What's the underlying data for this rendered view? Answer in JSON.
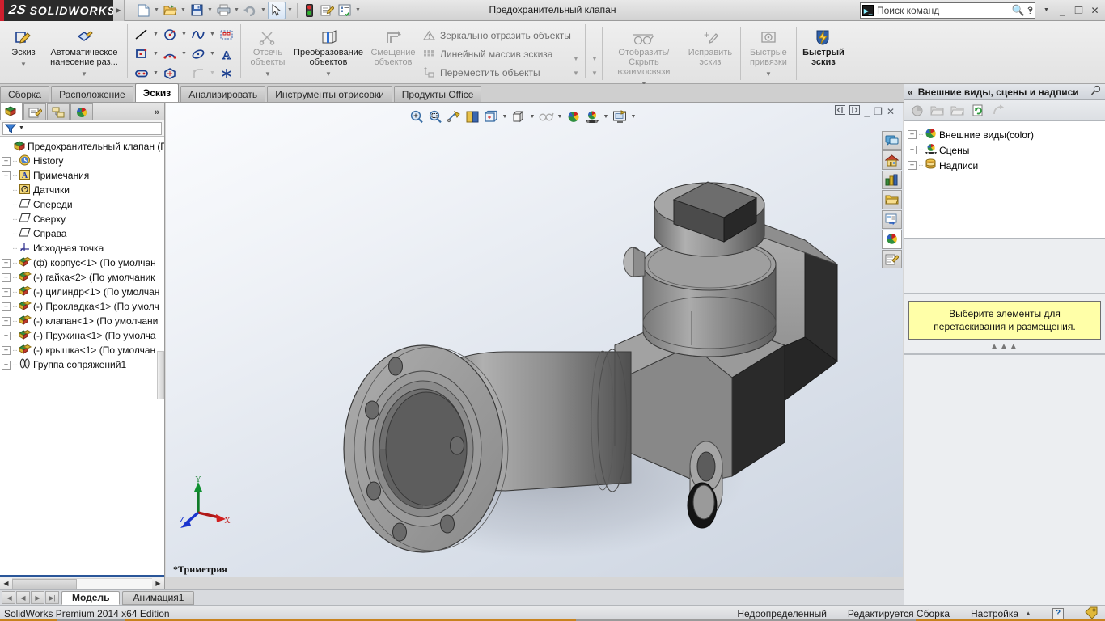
{
  "app": {
    "brand": "SOLIDWORKS",
    "brand_mark": "2S",
    "document_title": "Предохранительный клапан",
    "edition": "SolidWorks Premium 2014 x64 Edition"
  },
  "search": {
    "placeholder": "Поиск команд",
    "icon": "command-search-icon",
    "magnifier": "search-icon"
  },
  "quick_access": [
    {
      "name": "new-document",
      "icon": "📄"
    },
    {
      "name": "open-document",
      "icon": "📂"
    },
    {
      "name": "save-document",
      "icon": "💾"
    },
    {
      "name": "print-document",
      "icon": "🖨"
    },
    {
      "name": "undo",
      "icon": "↺"
    },
    {
      "name": "select",
      "icon": "➤"
    },
    {
      "name": "rebuild",
      "icon": "🚦"
    },
    {
      "name": "file-properties",
      "icon": "📝"
    },
    {
      "name": "options",
      "icon": "📋"
    }
  ],
  "window_buttons": [
    "help",
    "minimize",
    "restore",
    "close"
  ],
  "ribbon": {
    "groups": [
      {
        "name": "sketch-group",
        "buttons": [
          {
            "label": "Эскиз",
            "icon": "sketch-icon",
            "glyph": "✏",
            "disabled": false,
            "dropdown": true
          },
          {
            "label": "Автоматическое нанесение раз...",
            "icon": "smart-dimension-icon",
            "glyph": "◈",
            "disabled": false,
            "dropdown": true
          }
        ]
      },
      {
        "name": "entities-group",
        "rows": [
          [
            {
              "name": "line-tool",
              "glyph": "╲",
              "caret": true
            },
            {
              "name": "circle-tool",
              "glyph": "◯",
              "caret": true
            },
            {
              "name": "spline-tool",
              "glyph": "∿",
              "caret": true
            },
            {
              "name": "sketch-pattern-tool",
              "glyph": "▦",
              "caret": false
            }
          ],
          [
            {
              "name": "rectangle-tool",
              "glyph": "▭",
              "caret": true
            },
            {
              "name": "arc-tool",
              "glyph": "⌒",
              "caret": true
            },
            {
              "name": "ellipse-tool",
              "glyph": "⬭",
              "caret": true
            },
            {
              "name": "text-tool",
              "glyph": "A",
              "caret": false
            }
          ],
          [
            {
              "name": "slot-tool",
              "glyph": "⬬",
              "caret": true
            },
            {
              "name": "polygon-tool",
              "glyph": "⬡",
              "caret": false
            },
            {
              "name": "fillet-tool",
              "glyph": "⌐",
              "caret": true,
              "disabled": true
            },
            {
              "name": "point-tool",
              "glyph": "✳",
              "caret": false
            }
          ]
        ]
      },
      {
        "name": "modify-group",
        "buttons": [
          {
            "label": "Отсечь объекты",
            "icon": "trim-entities-icon",
            "glyph": "✂",
            "disabled": true,
            "dropdown": true
          },
          {
            "label": "Преобразование объектов",
            "icon": "convert-entities-icon",
            "glyph": "▱",
            "disabled": false,
            "dropdown": true
          },
          {
            "label": "Смещение объектов",
            "icon": "offset-entities-icon",
            "glyph": "⇗",
            "disabled": true,
            "dropdown": false
          }
        ],
        "list": [
          {
            "label": "Зеркально отразить объекты",
            "icon": "mirror-entities-icon",
            "glyph": "⚠"
          },
          {
            "label": "Линейный массив эскиза",
            "icon": "linear-pattern-icon",
            "glyph": "⣿"
          },
          {
            "label": "Переместить объекты",
            "icon": "move-entities-icon",
            "glyph": "⤵"
          }
        ]
      },
      {
        "name": "relations-group",
        "buttons": [
          {
            "label": "Отобразить/Скрыть взаимосвязи",
            "icon": "display-relations-icon",
            "glyph": "👓",
            "disabled": true,
            "dropdown": true
          },
          {
            "label": "Исправить эскиз",
            "icon": "repair-sketch-icon",
            "glyph": "✎",
            "disabled": true,
            "dropdown": false
          },
          {
            "label": "Быстрые привязки",
            "icon": "quick-snaps-icon",
            "glyph": "◎",
            "disabled": true,
            "dropdown": true
          },
          {
            "label": "Быстрый эскиз",
            "icon": "rapid-sketch-icon",
            "glyph": "⚡",
            "disabled": false,
            "dropdown": false
          }
        ]
      }
    ]
  },
  "command_tabs": [
    {
      "label": "Сборка",
      "active": false
    },
    {
      "label": "Расположение",
      "active": false
    },
    {
      "label": "Эскиз",
      "active": true
    },
    {
      "label": "Анализировать",
      "active": false
    },
    {
      "label": "Инструменты отрисовки",
      "active": false
    },
    {
      "label": "Продукты Office",
      "active": false
    }
  ],
  "tree_panel": {
    "tabs": [
      {
        "name": "feature-manager-tab",
        "glyph": "🗂",
        "active": true
      },
      {
        "name": "property-manager-tab",
        "glyph": "📝",
        "active": false
      },
      {
        "name": "configuration-manager-tab",
        "glyph": "🔖",
        "active": false
      },
      {
        "name": "display-manager-tab",
        "glyph": "🎨",
        "active": false
      }
    ],
    "expand_chevron": "»",
    "filter_icon": "filter-icon",
    "root": "Предохранительный клапан  (П",
    "items": [
      {
        "label": "History",
        "icon": "history-icon",
        "glyph": "🕐",
        "expandable": true
      },
      {
        "label": "Примечания",
        "icon": "annotations-icon",
        "glyph": "A",
        "expandable": true
      },
      {
        "label": "Датчики",
        "icon": "sensors-icon",
        "glyph": "◎",
        "expandable": false
      },
      {
        "label": "Спереди",
        "icon": "plane-icon",
        "glyph": "◇",
        "expandable": false
      },
      {
        "label": "Сверху",
        "icon": "plane-icon",
        "glyph": "◇",
        "expandable": false
      },
      {
        "label": "Справа",
        "icon": "plane-icon",
        "glyph": "◇",
        "expandable": false
      },
      {
        "label": "Исходная точка",
        "icon": "origin-icon",
        "glyph": "⤧",
        "expandable": false
      },
      {
        "label": "(ф) корпус<1>  (По умолчан",
        "icon": "component-icon",
        "glyph": "🧩",
        "expandable": true
      },
      {
        "label": "(-) гайка<2>  (По умолчаник",
        "icon": "component-icon",
        "glyph": "🧩",
        "expandable": true
      },
      {
        "label": "(-) цилиндр<1>  (По умолчан",
        "icon": "component-icon",
        "glyph": "🧩",
        "expandable": true
      },
      {
        "label": "(-) Прокладка<1>  (По умолч",
        "icon": "component-icon",
        "glyph": "🧩",
        "expandable": true
      },
      {
        "label": "(-) клапан<1>  (По умолчани",
        "icon": "component-icon",
        "glyph": "🧩",
        "expandable": true
      },
      {
        "label": "(-) Пружина<1>  (По умолча",
        "icon": "component-icon",
        "glyph": "🧩",
        "expandable": true
      },
      {
        "label": "(-) крышка<1>  (По умолчан",
        "icon": "component-icon",
        "glyph": "🧩",
        "expandable": true
      },
      {
        "label": "Группа сопряжений1",
        "icon": "mate-group-icon",
        "glyph": "🔗",
        "expandable": true
      }
    ]
  },
  "graphics": {
    "view_toolbar": [
      {
        "name": "zoom-to-fit",
        "glyph": "🔍",
        "caret": false
      },
      {
        "name": "zoom-to-area",
        "glyph": "🔎",
        "caret": false
      },
      {
        "name": "section-view",
        "glyph": "✂",
        "caret": false
      },
      {
        "name": "view-orientation",
        "glyph": "📖",
        "caret": false
      },
      {
        "name": "display-style",
        "glyph": "🗂",
        "caret": true
      },
      {
        "name": "hide-show-items",
        "glyph": "⬜",
        "caret": true
      },
      {
        "name": "edit-appearance",
        "glyph": "👓",
        "caret": true
      },
      {
        "name": "apply-scene",
        "glyph": "🔴",
        "caret": false
      },
      {
        "name": "view-settings",
        "glyph": "🎨",
        "caret": true
      },
      {
        "name": "display-pane",
        "glyph": "🖼",
        "caret": true
      }
    ],
    "window_controls": [
      "restore-left",
      "restore-right",
      "minimize",
      "restore",
      "close"
    ],
    "triad": {
      "x": "X",
      "y": "Y",
      "z": "Z"
    },
    "view_name": "*Триметрия"
  },
  "task_pane": {
    "strip": [
      {
        "name": "solidworks-resources",
        "glyph": "💬"
      },
      {
        "name": "design-library",
        "glyph": "🏠"
      },
      {
        "name": "file-explorer",
        "glyph": "📊"
      },
      {
        "name": "search-folder",
        "glyph": "📁"
      },
      {
        "name": "view-palette",
        "glyph": "🗃"
      },
      {
        "name": "appearances-scenes",
        "glyph": "🔴",
        "active": true
      },
      {
        "name": "custom-properties",
        "glyph": "📝"
      }
    ],
    "title": "Внешние виды, сцены и надписи",
    "collapse_chevron": "«",
    "pin_icon": "pin-icon",
    "toolbar": [
      {
        "name": "back-button",
        "glyph": "◔"
      },
      {
        "name": "open-folder-button",
        "glyph": "📂"
      },
      {
        "name": "new-folder-button",
        "glyph": "📁"
      },
      {
        "name": "refresh-button",
        "glyph": "🔄",
        "active": true
      },
      {
        "name": "forward-button",
        "glyph": "➶"
      }
    ],
    "items": [
      {
        "label": "Внешние виды(color)",
        "icon": "appearances-icon",
        "glyph": "🔴"
      },
      {
        "label": "Сцены",
        "icon": "scenes-icon",
        "glyph": "🎬"
      },
      {
        "label": "Надписи",
        "icon": "decals-icon",
        "glyph": "🥫"
      }
    ],
    "tip": "Выберите элементы для перетаскивания и размещения."
  },
  "document_tabs": [
    {
      "label": "Модель",
      "active": true
    },
    {
      "label": "Анимация1",
      "active": false
    }
  ],
  "nav_buttons": [
    "first",
    "previous",
    "next",
    "last"
  ],
  "status_bar": {
    "left": "SolidWorks Premium 2014 x64 Edition",
    "state": "Недоопределенный",
    "editing": "Редактируется Сборка",
    "custom": "Настройка",
    "caret": "▲",
    "help": "?",
    "tag_icon": "tag-icon"
  },
  "colors": {
    "brand_red": "#cf1f2e",
    "titlebar_dark": "#2b2b2b",
    "tip_yellow": "#ffffa8",
    "tree_select_blue": "#2a5699",
    "axis_x": "#d12020",
    "axis_y": "#0f9030",
    "axis_z": "#1a35cf"
  }
}
